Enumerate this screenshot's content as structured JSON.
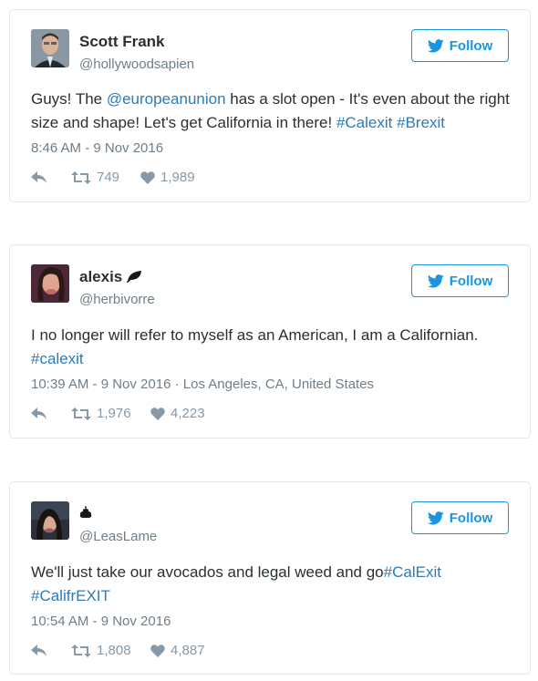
{
  "tweets": [
    {
      "name": "Scott Frank",
      "handle": "@hollywoodsapien",
      "follow_label": "Follow",
      "text_parts": [
        "Guys! The ",
        "@europeanunion",
        " has a slot open - It's even about the right size and shape! Let's get California in there! ",
        "#Calexit",
        " ",
        "#Brexit"
      ],
      "timestamp": "8:46 AM - 9 Nov 2016",
      "retweets": "749",
      "likes": "1,989"
    },
    {
      "name": "alexis",
      "handle": "@herbivorre",
      "follow_label": "Follow",
      "text_parts": [
        "I no longer will refer to myself as an American, I am a Californian. ",
        "#calexit"
      ],
      "timestamp": "10:39 AM - 9 Nov 2016 · Los Angeles, CA, United States",
      "retweets": "1,976",
      "likes": "4,223"
    },
    {
      "name": "",
      "handle": "@LeasLame",
      "follow_label": "Follow",
      "text_parts": [
        "We'll just take our avocados and legal weed and go",
        "#CalExit",
        " ",
        "#CalifrEXIT"
      ],
      "timestamp": "10:54 AM - 9 Nov 2016",
      "retweets": "1,808",
      "likes": "4,887"
    }
  ],
  "colors": {
    "accent": "#1b95e0",
    "link": "#2b7bb9",
    "muted": "#707e88",
    "border": "#e1e8ed"
  },
  "icons": [
    "reply-icon",
    "retweet-icon",
    "heart-icon",
    "twitter-bird-icon",
    "leaf-emoji-icon",
    "poop-emoji-icon"
  ]
}
